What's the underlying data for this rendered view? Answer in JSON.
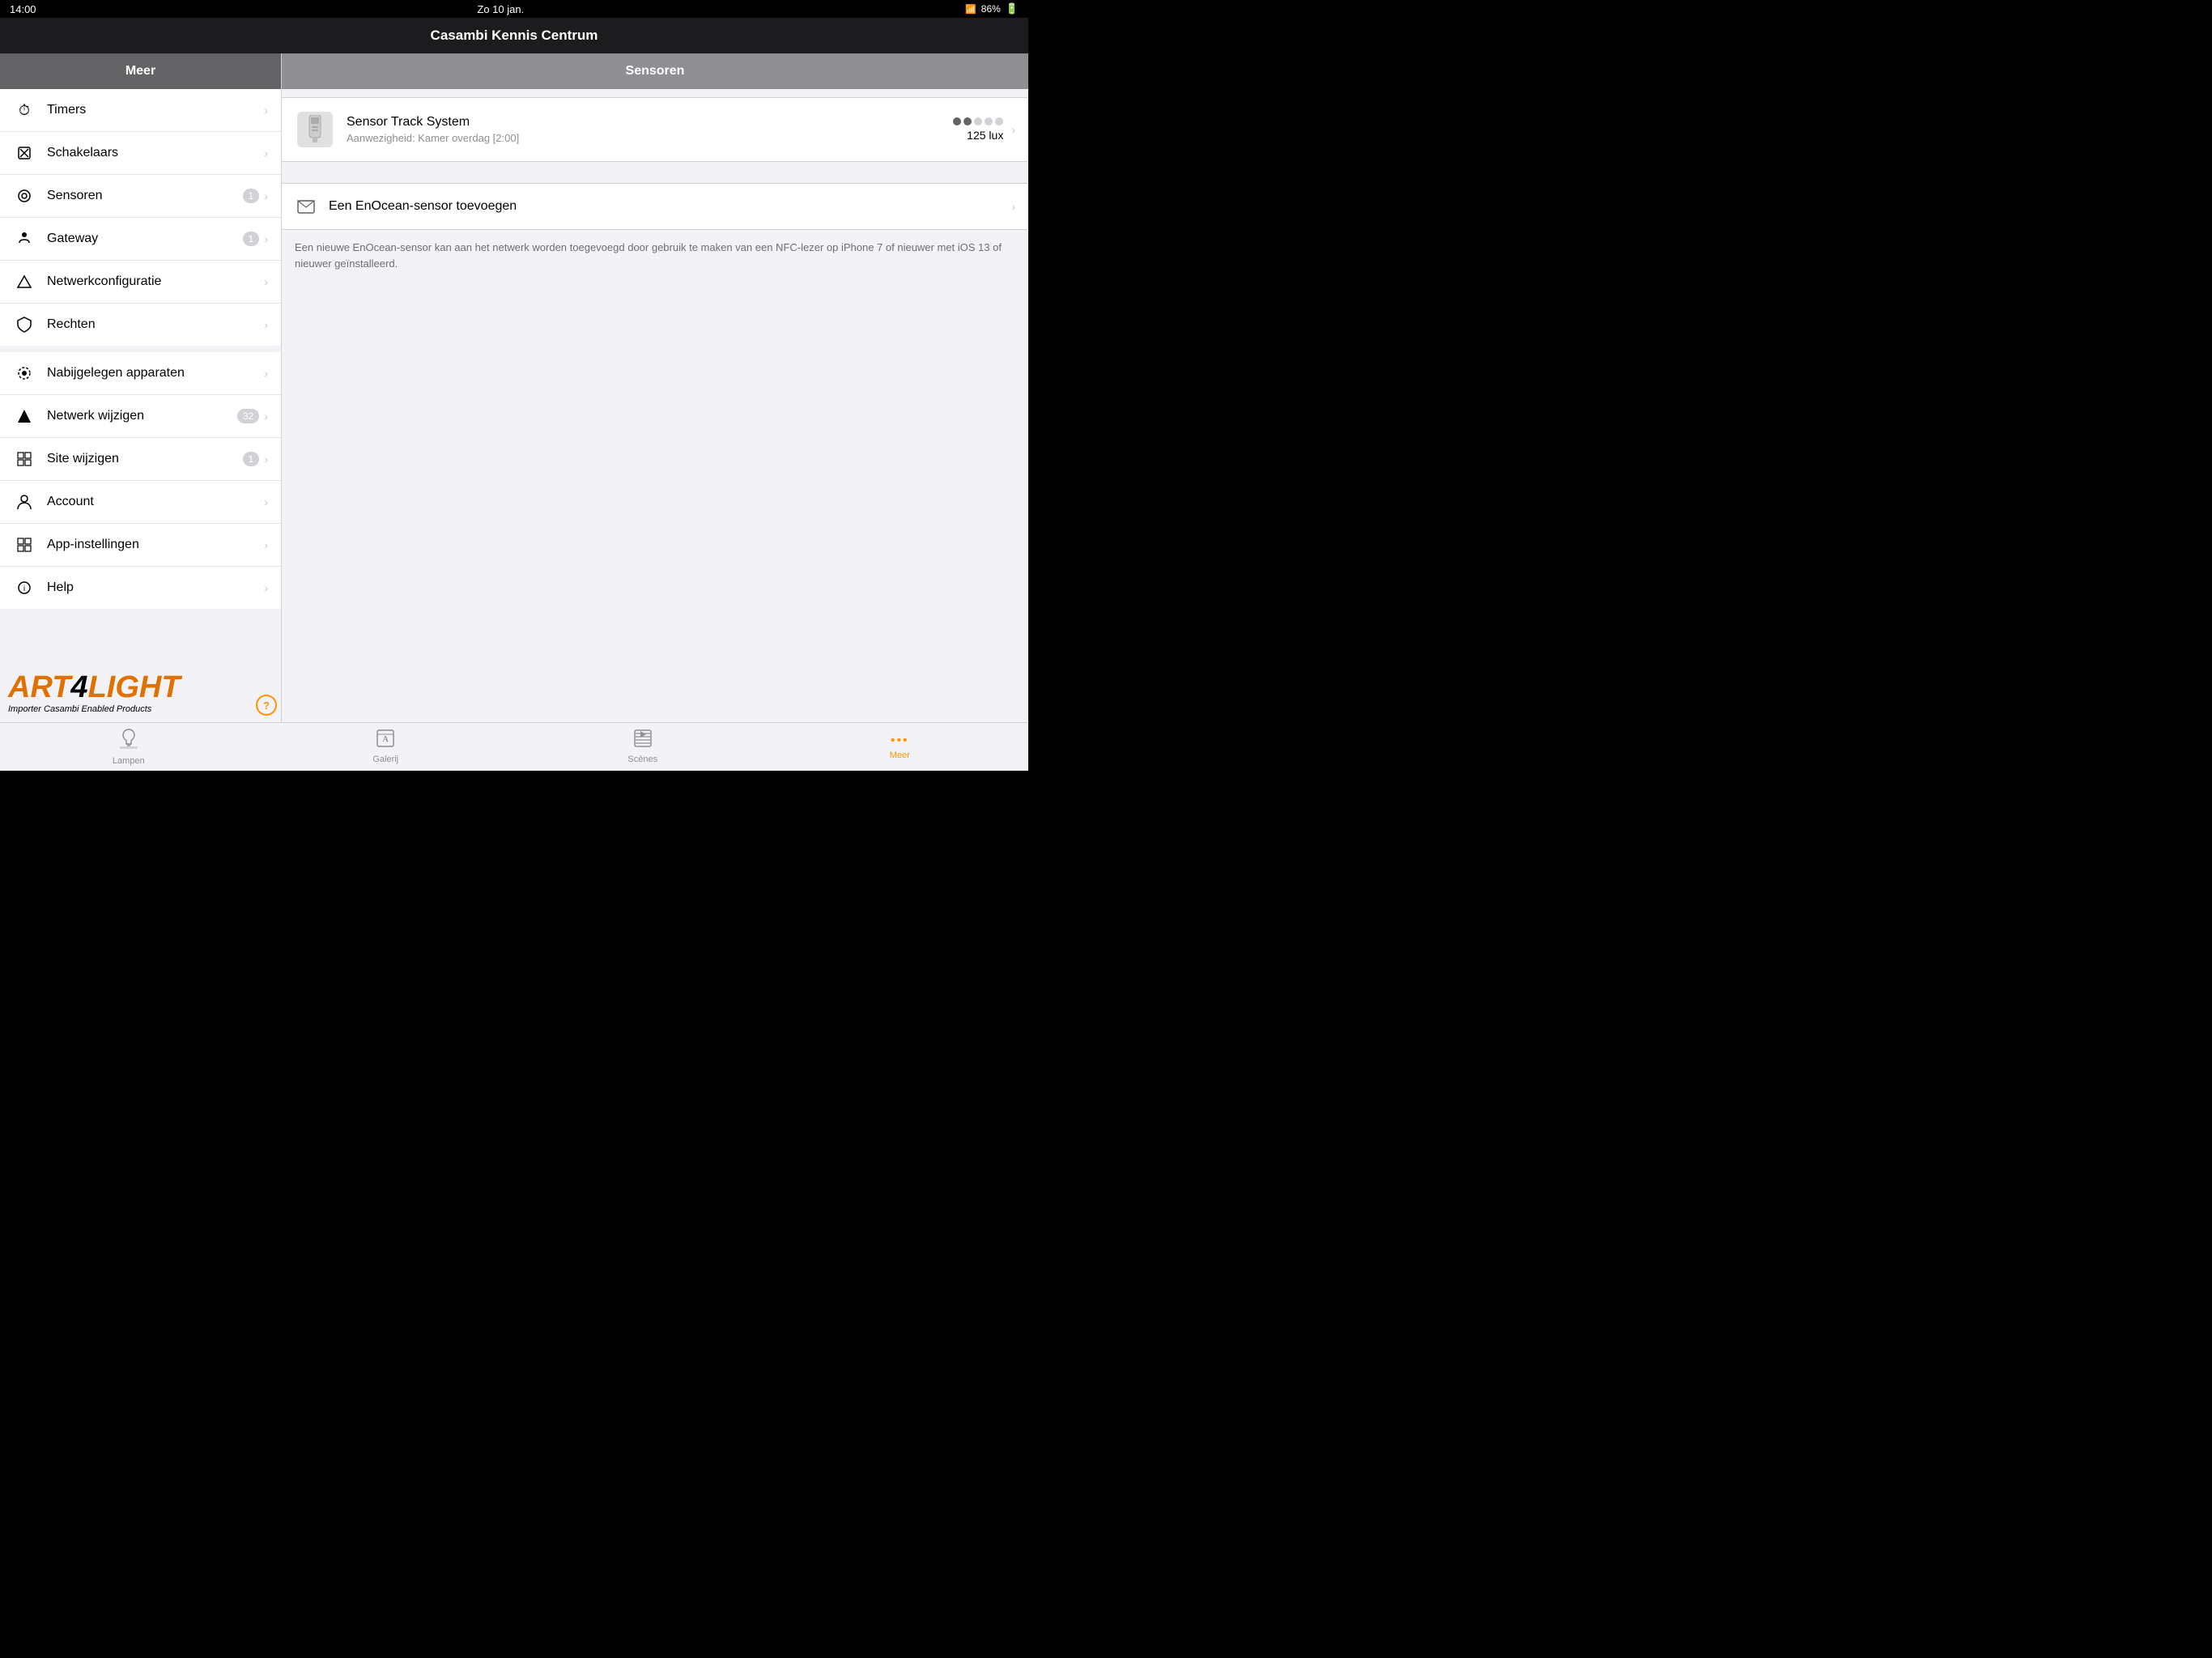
{
  "statusBar": {
    "time": "14:00",
    "day": "Zo 10 jan.",
    "battery": "86%",
    "wifiIcon": "wifi"
  },
  "titleBar": {
    "title": "Casambi Kennis Centrum"
  },
  "sidebar": {
    "header": "Meer",
    "sections": [
      {
        "items": [
          {
            "id": "timers",
            "icon": "⏱",
            "label": "Timers",
            "badge": null
          },
          {
            "id": "schakelaars",
            "icon": "✕",
            "label": "Schakelaars",
            "badge": null
          },
          {
            "id": "sensoren",
            "icon": "◎",
            "label": "Sensoren",
            "badge": "1"
          },
          {
            "id": "gateway",
            "icon": "▲",
            "label": "Gateway",
            "badge": "1"
          },
          {
            "id": "netwerkconfiguratie",
            "icon": "△",
            "label": "Netwerkconfiguratie",
            "badge": null
          },
          {
            "id": "rechten",
            "icon": "◈",
            "label": "Rechten",
            "badge": null
          }
        ]
      },
      {
        "items": [
          {
            "id": "nabijgelegen",
            "icon": "◉",
            "label": "Nabijgelegen apparaten",
            "badge": null
          },
          {
            "id": "netwerk-wijzigen",
            "icon": "△",
            "label": "Netwerk wijzigen",
            "badge": "32"
          },
          {
            "id": "site-wijzigen",
            "icon": "▦",
            "label": "Site wijzigen",
            "badge": "1"
          },
          {
            "id": "account",
            "icon": "👤",
            "label": "Account",
            "badge": null
          },
          {
            "id": "app-instellingen",
            "icon": "▦",
            "label": "App-instellingen",
            "badge": null
          },
          {
            "id": "help",
            "icon": "ℹ",
            "label": "Help",
            "badge": null
          }
        ]
      }
    ]
  },
  "rightPanel": {
    "header": "Sensoren",
    "sensor": {
      "name": "Sensor Track System",
      "status": "Aanwezigheid: Kamer overdag [2:00]",
      "lux": "125 lux",
      "dots": [
        true,
        true,
        false,
        false,
        false
      ]
    },
    "addSensor": {
      "label": "Een EnOcean-sensor toevoegen",
      "icon": "🖼"
    },
    "description": "Een nieuwe EnOcean-sensor kan aan het netwerk worden toegevoegd door gebruik te maken van een NFC-lezer op iPhone 7 of nieuwer met iOS 13 of nieuwer geïnstalleerd."
  },
  "tabBar": {
    "tabs": [
      {
        "id": "lampen",
        "icon": "💡",
        "label": "Lampen",
        "active": false
      },
      {
        "id": "galerij",
        "icon": "🖼",
        "label": "Galerij",
        "active": false
      },
      {
        "id": "scenes",
        "icon": "▶",
        "label": "Scènes",
        "active": false
      },
      {
        "id": "meer",
        "icon": "•••",
        "label": "Meer",
        "active": true
      }
    ]
  },
  "watermark": {
    "line1": "ART4LIGHT",
    "line2": "Importer Casambi Enabled Products"
  },
  "helpButton": "?"
}
